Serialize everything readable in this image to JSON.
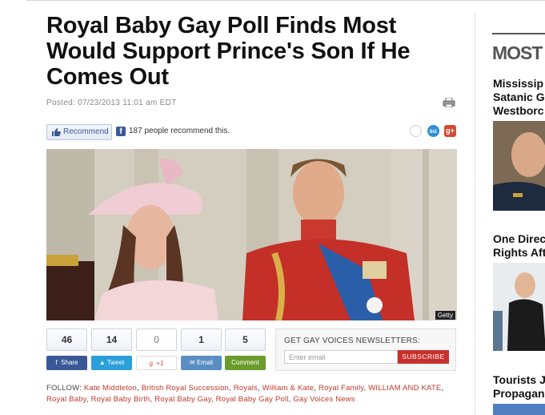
{
  "article": {
    "headline": "Royal Baby Gay Poll Finds Most Would Support Prince's Son If He Comes Out",
    "posted": "Posted: 07/23/2013 11:01 am EDT"
  },
  "recommend": {
    "button_label": "Recommend",
    "count_text": "187 people recommend this."
  },
  "photo": {
    "credit": "Getty"
  },
  "share": {
    "counters": [
      {
        "count": "46",
        "label": "Share",
        "color": "#3b5998",
        "icon": "facebook-icon"
      },
      {
        "count": "14",
        "label": "Tweet",
        "color": "#2b9fd9",
        "icon": "twitter-icon"
      },
      {
        "count": "0",
        "label": "+1",
        "color": "#dd4b39",
        "icon": "google-plus-icon"
      },
      {
        "count": "1",
        "label": "Email",
        "color": "#5a8dc4",
        "icon": "mail-icon"
      },
      {
        "count": "5",
        "label": "Comment",
        "color": "#6a9c2b",
        "icon": "comment-icon"
      }
    ]
  },
  "newsletter": {
    "title": "GET GAY VOICES NEWSLETTERS:",
    "placeholder": "Enter email",
    "button_label": "SUBSCRIBE"
  },
  "follow": {
    "label": "FOLLOW:",
    "tags": [
      "Kate Middleton",
      "British Royal Succession",
      "Royals",
      "William & Kate",
      "Royal Family",
      "WILLIAM AND KATE",
      "Royal Baby",
      "Royal Baby Birth",
      "Royal Baby Gay",
      "Royal Baby Gay Poll",
      "Gay Voices News"
    ]
  },
  "sidebar": {
    "title": "MOST P",
    "stories": [
      {
        "headline_lines": [
          "Mississip",
          "Satanic G",
          "Westborc"
        ]
      },
      {
        "headline_lines": [
          "One Direc",
          "Rights Aft"
        ]
      },
      {
        "headline_lines": [
          "Tourists J",
          "Propagan"
        ]
      }
    ]
  },
  "colors": {
    "accent_link": "#c0392b",
    "subscribe": "#c9302c",
    "facebook": "#3b5998"
  }
}
